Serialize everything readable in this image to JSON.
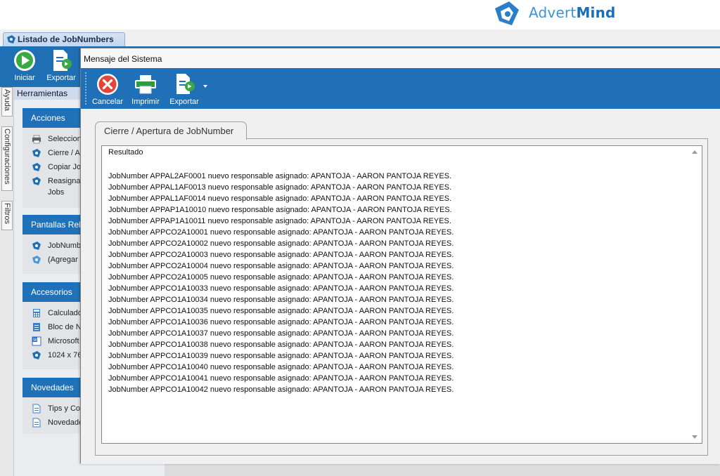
{
  "brand": {
    "name_light": "Advert",
    "name_bold": "Mind"
  },
  "doc_tab": {
    "label": "Listado de JobNumbers"
  },
  "main_toolbar": {
    "start_label": "Iniciar",
    "export_label": "Exportar"
  },
  "side_tabs": [
    "Ayuda",
    "Configuraciones",
    "Filtros"
  ],
  "tools_header": "Herramientas",
  "panels": {
    "acciones": {
      "title": "Acciones",
      "items": [
        "Seleccion",
        "Cierre / A",
        "Copiar Jo",
        "Reasignar",
        "Jobs"
      ]
    },
    "pantallas": {
      "title": "Pantallas Relac",
      "items": [
        "JobNumbe",
        "(Agregar"
      ]
    },
    "accesorios": {
      "title": "Accesorios",
      "items": [
        "Calculado",
        "Bloc de N",
        "Microsoft",
        "1024 x 76"
      ]
    },
    "novedades": {
      "title": "Novedades",
      "items": [
        "Tips y Co",
        "Novedade"
      ]
    }
  },
  "modal": {
    "title": "Mensaje del Sistema",
    "toolbar": {
      "cancel_label": "Cancelar",
      "print_label": "Imprimir",
      "export_label": "Exportar"
    },
    "tab_label": "Cierre / Apertura de JobNumber",
    "result_label": "Resultado",
    "lines": [
      "JobNumber APPAL2AF0001 nuevo responsable asignado: APANTOJA - AARON PANTOJA REYES.",
      "JobNumber APPAL1AF0013 nuevo responsable asignado: APANTOJA - AARON PANTOJA REYES.",
      "JobNumber APPAL1AF0014 nuevo responsable asignado: APANTOJA - AARON PANTOJA REYES.",
      "JobNumber APPAP1A10010 nuevo responsable asignado: APANTOJA - AARON PANTOJA REYES.",
      "JobNumber APPAP1A10011 nuevo responsable asignado: APANTOJA - AARON PANTOJA REYES.",
      "JobNumber APPCO2A10001 nuevo responsable asignado: APANTOJA - AARON PANTOJA REYES.",
      "JobNumber APPCO2A10002 nuevo responsable asignado: APANTOJA - AARON PANTOJA REYES.",
      "JobNumber APPCO2A10003 nuevo responsable asignado: APANTOJA - AARON PANTOJA REYES.",
      "JobNumber APPCO2A10004 nuevo responsable asignado: APANTOJA - AARON PANTOJA REYES.",
      "JobNumber APPCO2A10005 nuevo responsable asignado: APANTOJA - AARON PANTOJA REYES.",
      "JobNumber APPCO1A10033 nuevo responsable asignado: APANTOJA - AARON PANTOJA REYES.",
      "JobNumber APPCO1A10034 nuevo responsable asignado: APANTOJA - AARON PANTOJA REYES.",
      "JobNumber APPCO1A10035 nuevo responsable asignado: APANTOJA - AARON PANTOJA REYES.",
      "JobNumber APPCO1A10036 nuevo responsable asignado: APANTOJA - AARON PANTOJA REYES.",
      "JobNumber APPCO1A10037 nuevo responsable asignado: APANTOJA - AARON PANTOJA REYES.",
      "JobNumber APPCO1A10038 nuevo responsable asignado: APANTOJA - AARON PANTOJA REYES.",
      "JobNumber APPCO1A10039 nuevo responsable asignado: APANTOJA - AARON PANTOJA REYES.",
      "JobNumber APPCO1A10040 nuevo responsable asignado: APANTOJA - AARON PANTOJA REYES.",
      "JobNumber APPCO1A10041 nuevo responsable asignado: APANTOJA - AARON PANTOJA REYES.",
      "JobNumber APPCO1A10042 nuevo responsable asignado: APANTOJA - AARON PANTOJA REYES."
    ]
  },
  "colors": {
    "ribbon": "#1f70b7",
    "panel_header": "#1f72b9",
    "brand_light": "#3b95d3",
    "brand_dark": "#1b6fb7"
  },
  "icons": [
    "brand-logo-icon",
    "play-icon",
    "export-icon",
    "cancel-icon",
    "print-icon",
    "printer-icon",
    "logo-icon",
    "calculator-icon",
    "notepad-icon",
    "word-icon",
    "document-icon"
  ]
}
